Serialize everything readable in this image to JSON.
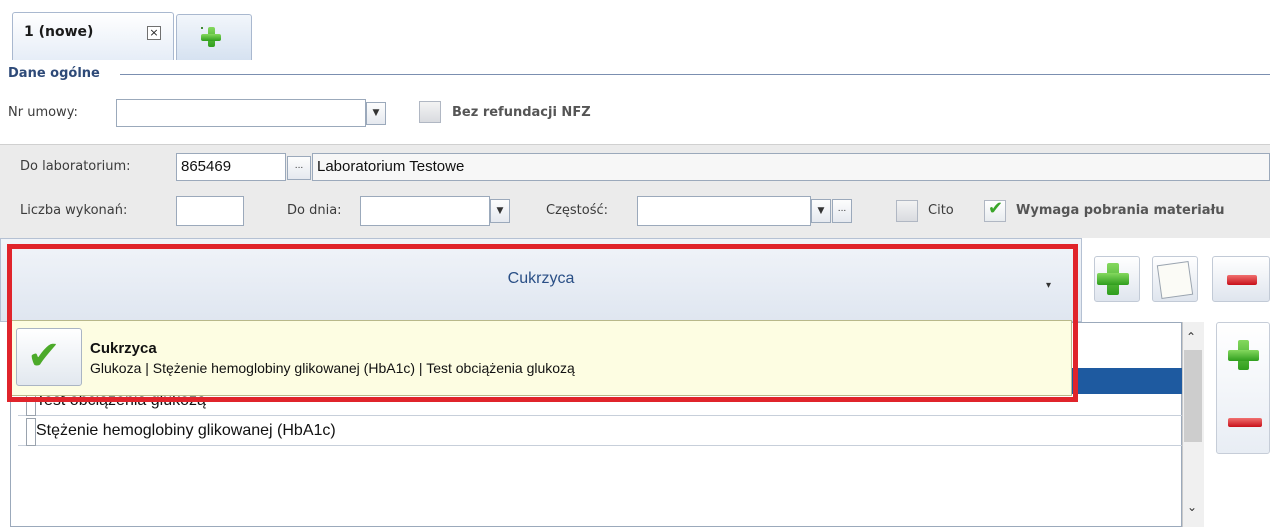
{
  "tabs": [
    {
      "label": "1 (nowe)",
      "close_symbol": "×"
    },
    {
      "icon": "plus-icon"
    }
  ],
  "section": {
    "title": "Dane ogólne"
  },
  "contract": {
    "label": "Nr umowy:",
    "value": ""
  },
  "no_refund": {
    "label": "Bez refundacji NFZ",
    "checked": false
  },
  "lab": {
    "label": "Do laboratorium:",
    "code": "865469",
    "browse_label": "...",
    "name": "Laboratorium Testowe"
  },
  "executions": {
    "label": "Liczba wykonań:",
    "value": ""
  },
  "until": {
    "label": "Do dnia:",
    "value": ""
  },
  "frequency": {
    "label": "Częstość:",
    "value": "",
    "browse_label": "..."
  },
  "cito": {
    "label": "Cito",
    "checked": false
  },
  "sample_required": {
    "label": "Wymaga pobrania materiału",
    "checked": true
  },
  "dictionary": {
    "selected": "Cukrzyca"
  },
  "suggestion": {
    "title": "Cukrzyca",
    "details": "Glukoza | Stężenie hemoglobiny glikowanej (HbA1c) | Test obciążenia glukozą"
  },
  "tests": [
    {
      "name": "Test obciążenia glukozą"
    },
    {
      "name": "Stężenie hemoglobiny glikowanej (HbA1c)"
    }
  ],
  "colors": {
    "highlight_frame": "#e0242b",
    "accent": "#2a4f86",
    "selected_row": "#1e5aa0"
  }
}
